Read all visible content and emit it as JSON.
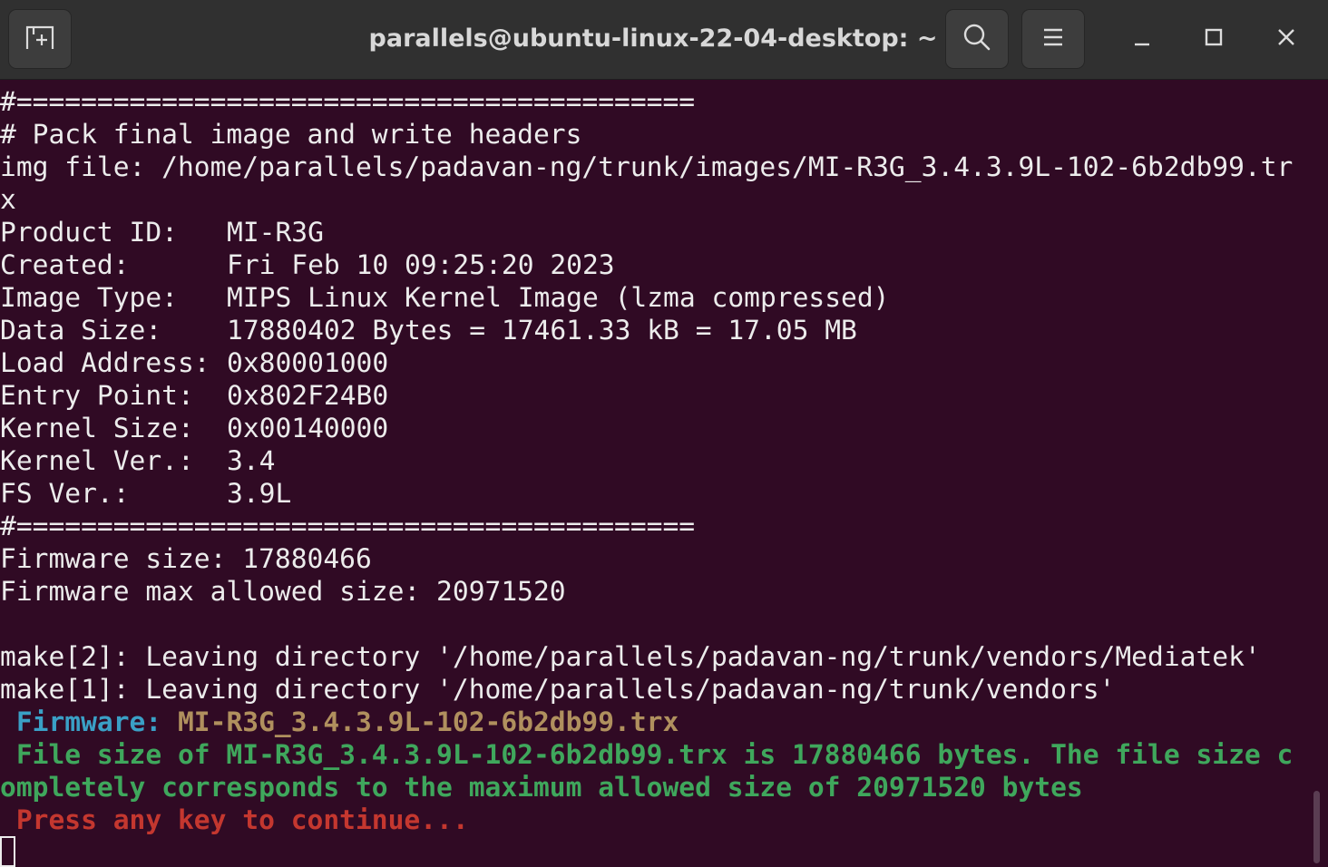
{
  "window": {
    "title": "parallels@ubuntu-linux-22-04-desktop: ~",
    "icons": {
      "new_tab": "new-tab-icon",
      "search": "search-icon",
      "menu": "hamburger-menu-icon",
      "minimize": "minimize-icon",
      "maximize": "maximize-icon",
      "close": "close-icon"
    }
  },
  "colors": {
    "terminal_bg": "#300a24",
    "titlebar_bg": "#303030",
    "text": "#ececec",
    "firmware_label": "#3aa0c6",
    "firmware_name": "#b0905e",
    "success": "#3fa75c",
    "prompt": "#c4372f"
  },
  "terminal": {
    "sep1": "#==========================================",
    "heading": "# Pack final image and write headers",
    "img_file_1": "img file: /home/parallels/padavan-ng/trunk/images/MI-R3G_3.4.3.9L-102-6b2db99.tr",
    "img_file_2": "x",
    "info": [
      {
        "label": "Product ID:",
        "value": "MI-R3G"
      },
      {
        "label": "Created:",
        "value": "Fri Feb 10 09:25:20 2023"
      },
      {
        "label": "Image Type:",
        "value": "MIPS Linux Kernel Image (lzma compressed)"
      },
      {
        "label": "Data Size:",
        "value": "17880402 Bytes = 17461.33 kB = 17.05 MB"
      },
      {
        "label": "Load Address:",
        "value": "0x80001000"
      },
      {
        "label": "Entry Point:",
        "value": "0x802F24B0"
      },
      {
        "label": "Kernel Size:",
        "value": "0x00140000"
      },
      {
        "label": "Kernel Ver.:",
        "value": "3.4"
      },
      {
        "label": "FS Ver.:",
        "value": "3.9L"
      }
    ],
    "sep2": "#==========================================",
    "fw_size": "Firmware size: 17880466",
    "fw_max": "Firmware max allowed size: 20971520",
    "make2": "make[2]: Leaving directory '/home/parallels/padavan-ng/trunk/vendors/Mediatek'",
    "make1": "make[1]: Leaving directory '/home/parallels/padavan-ng/trunk/vendors'",
    "firmware_label": " Firmware:",
    "firmware_name": " MI-R3G_3.4.3.9L-102-6b2db99.trx",
    "result_1": " File size of MI-R3G_3.4.3.9L-102-6b2db99.trx is 17880466 bytes. The file size c",
    "result_2": "ompletely corresponds to the maximum allowed size of 20971520 bytes",
    "press_key": " Press any key to continue..."
  }
}
